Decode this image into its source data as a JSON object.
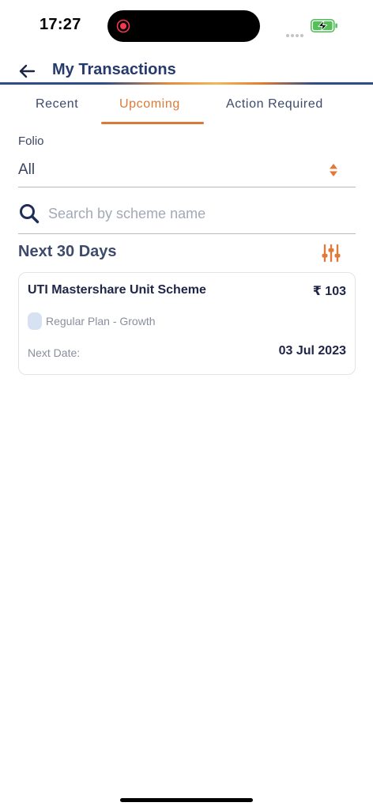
{
  "status_bar": {
    "time": "17:27"
  },
  "header": {
    "title": "My Transactions"
  },
  "tabs": [
    {
      "label": "Recent",
      "active": false
    },
    {
      "label": "Upcoming",
      "active": true
    },
    {
      "label": "Action Required",
      "active": false
    }
  ],
  "folio": {
    "label": "Folio",
    "value": "All"
  },
  "search": {
    "placeholder": "Search by scheme name",
    "value": ""
  },
  "section": {
    "title": "Next 30 Days"
  },
  "transactions": [
    {
      "scheme": "UTI Mastershare Unit Scheme",
      "amount": "₹ 103",
      "plan": "Regular Plan - Growth",
      "next_date_label": "Next Date:",
      "next_date": "03 Jul 2023"
    }
  ],
  "colors": {
    "accent": "#d97b37",
    "primary": "#263a6c",
    "text": "#1f2547",
    "muted": "#8a8f9c"
  },
  "icons": {
    "back": "arrow-left-icon",
    "search": "search-icon",
    "filter": "sliders-icon",
    "sort": "sort-updown-icon",
    "plan": "plan-badge-icon"
  }
}
